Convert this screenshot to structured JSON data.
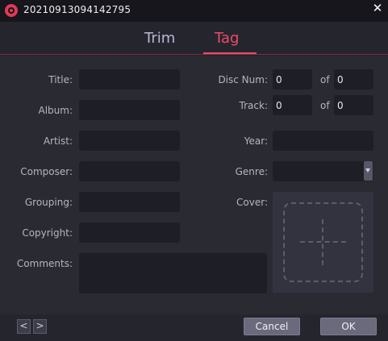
{
  "window": {
    "title": "20210913094142795"
  },
  "tabs": {
    "trim": "Trim",
    "tag": "Tag"
  },
  "fields": {
    "title": {
      "label": "Title:",
      "value": ""
    },
    "album": {
      "label": "Album:",
      "value": ""
    },
    "artist": {
      "label": "Artist:",
      "value": ""
    },
    "composer": {
      "label": "Composer:",
      "value": ""
    },
    "grouping": {
      "label": "Grouping:",
      "value": ""
    },
    "copyright": {
      "label": "Copyright:",
      "value": ""
    },
    "comments": {
      "label": "Comments:",
      "value": ""
    },
    "disc_num": {
      "label": "Disc Num:",
      "value": "0",
      "of_label": "of",
      "total": "0"
    },
    "track": {
      "label": "Track:",
      "value": "0",
      "of_label": "of",
      "total": "0"
    },
    "year": {
      "label": "Year:",
      "value": ""
    },
    "genre": {
      "label": "Genre:",
      "value": ""
    },
    "cover": {
      "label": "Cover:"
    }
  },
  "footer": {
    "prev": "<",
    "next": ">",
    "cancel": "Cancel",
    "ok": "OK"
  },
  "colors": {
    "accent": "#ec4c68",
    "background": "#2a2a33",
    "field": "#1e1e26"
  },
  "icons": {
    "app": "app-logo-icon",
    "close": "close-icon",
    "cover": "add-cover-icon",
    "dropdown": "chevron-down-icon"
  }
}
